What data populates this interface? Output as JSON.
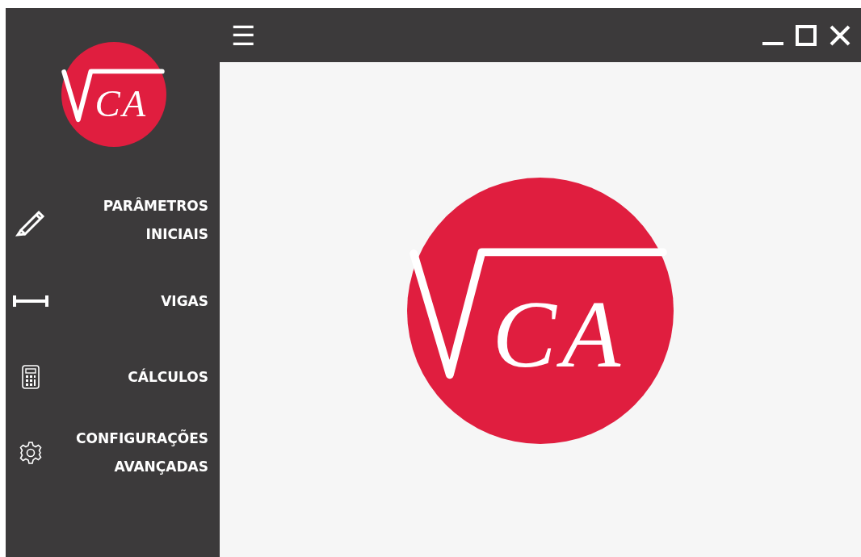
{
  "sidebar": {
    "logo": {
      "text": "CA"
    },
    "items": [
      {
        "kind": "pencil",
        "label": "PARÂMETROS INICIAIS"
      },
      {
        "kind": "beam",
        "label": "VIGAS"
      },
      {
        "kind": "calculator",
        "label": "CÁLCULOS"
      },
      {
        "kind": "gear",
        "label": "CONFIGURAÇÕES AVANÇADAS"
      }
    ]
  },
  "title_bar": {
    "menu_button": "☰"
  },
  "main": {
    "logo": {
      "text": "CA"
    }
  }
}
